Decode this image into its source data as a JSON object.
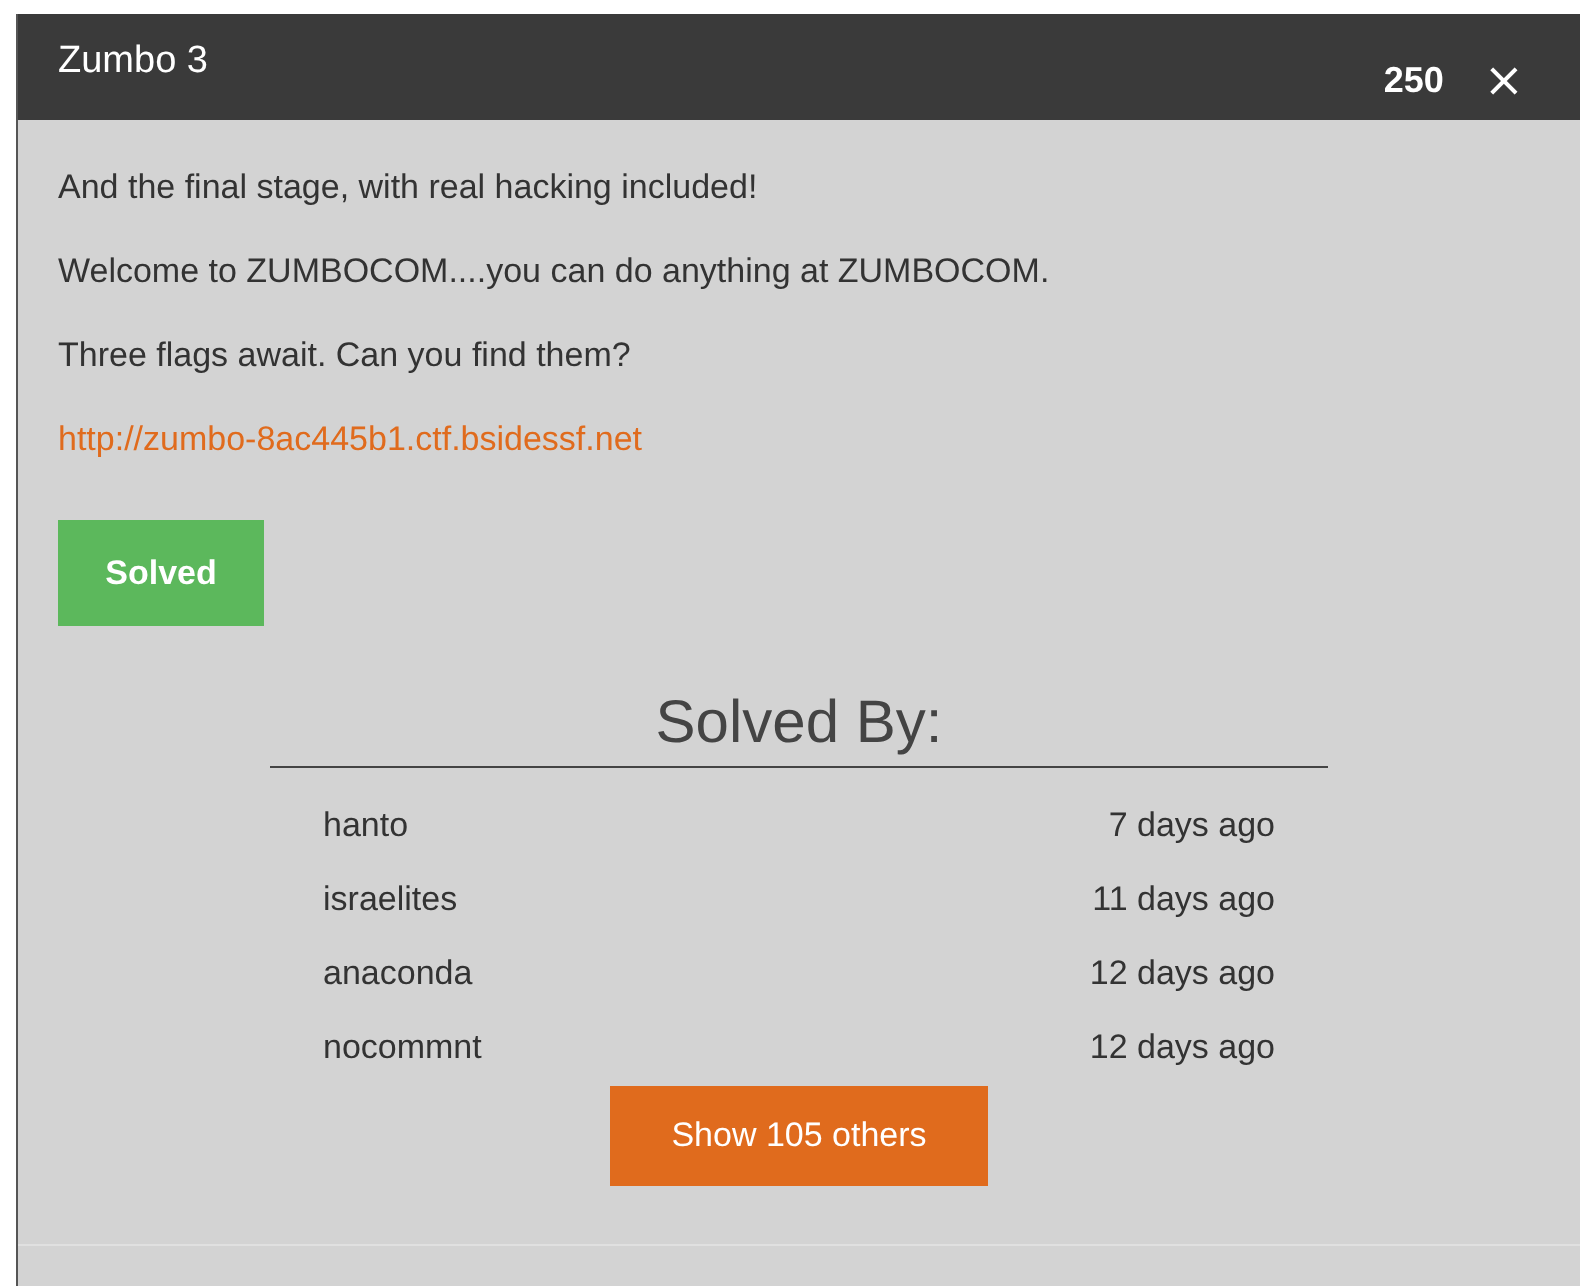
{
  "window": {
    "title": "Zumbo 3",
    "points": "250",
    "close": "×"
  },
  "description": [
    "And the final stage, with real hacking included!",
    "Welcome to ZUMBOCOM....you can do anything at ZUMBOCOM.",
    "Three flags await. Can you find them?"
  ],
  "link": "http://zumbo-8ac445b1.ctf.bsidessf.net",
  "status_button": "Solved",
  "solved_by": {
    "heading": "Solved By:",
    "solvers": [
      {
        "name": "hanto",
        "time": "7 days ago"
      },
      {
        "name": "israelites",
        "time": "11 days ago"
      },
      {
        "name": "anaconda",
        "time": "12 days ago"
      },
      {
        "name": "nocommnt",
        "time": "12 days ago"
      }
    ],
    "more_button": "Show 105 others"
  }
}
